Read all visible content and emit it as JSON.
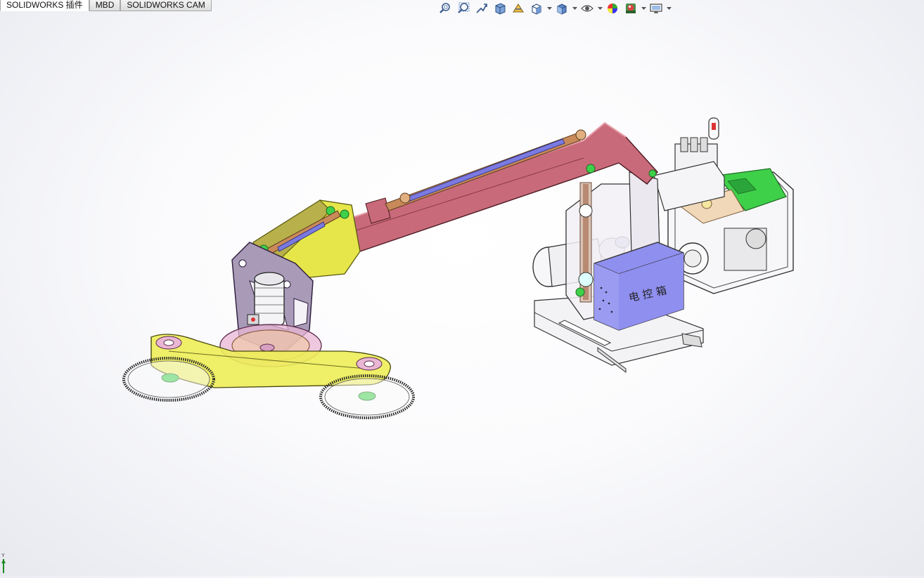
{
  "tabs": [
    {
      "label": "SOLIDWORKS 插件",
      "active": true
    },
    {
      "label": "MBD",
      "active": false
    },
    {
      "label": "SOLIDWORKS CAM",
      "active": false
    }
  ],
  "heads_up_toolbar": [
    {
      "icon": "zoom-to-fit-icon"
    },
    {
      "icon": "zoom-to-area-icon"
    },
    {
      "icon": "previous-view-icon"
    },
    {
      "icon": "section-view-icon"
    },
    {
      "icon": "dynamic-annotation-icon"
    },
    {
      "icon": "view-orientation-icon",
      "dropdown": true
    },
    {
      "icon": "display-style-icon",
      "dropdown": true
    },
    {
      "icon": "hide-show-items-icon",
      "dropdown": true
    },
    {
      "icon": "edit-appearance-icon"
    },
    {
      "icon": "apply-scene-icon",
      "dropdown": true
    },
    {
      "icon": "view-settings-icon",
      "dropdown": true
    }
  ],
  "model": {
    "control_box_label": "电 控 箱"
  },
  "triad": {
    "axis_label": "Y"
  },
  "colors": {
    "arm": "#c96a7a",
    "bracket": "#a99ab8",
    "saw_guard": "#e6e64a",
    "control_box": "#8f8ff0",
    "generator": "#3fd04a",
    "cylinder": "#c98a5a",
    "hydraulic_rod": "#7a7ae0"
  }
}
